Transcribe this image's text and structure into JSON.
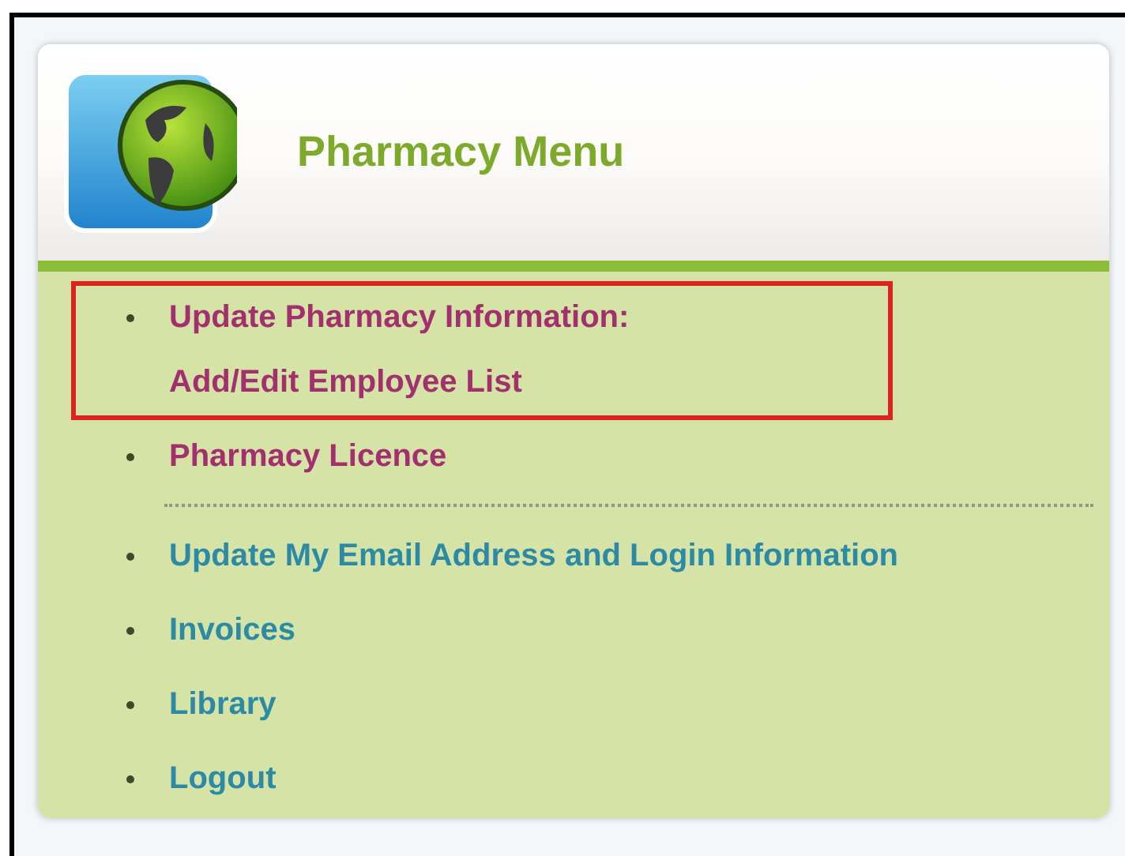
{
  "panel": {
    "title": "Pharmacy Menu"
  },
  "groups": [
    {
      "items": [
        {
          "lines": [
            "Update Pharmacy Information:",
            "Add/Edit Employee List"
          ],
          "visited": true,
          "highlighted": true
        },
        {
          "lines": [
            "Pharmacy Licence"
          ],
          "visited": true,
          "highlighted": false
        }
      ]
    },
    {
      "items": [
        {
          "lines": [
            "Update My Email Address and Login Information"
          ],
          "visited": false,
          "highlighted": false
        },
        {
          "lines": [
            "Invoices"
          ],
          "visited": false,
          "highlighted": false
        },
        {
          "lines": [
            "Library"
          ],
          "visited": false,
          "highlighted": false
        },
        {
          "lines": [
            "Logout"
          ],
          "visited": false,
          "highlighted": false
        }
      ]
    }
  ]
}
